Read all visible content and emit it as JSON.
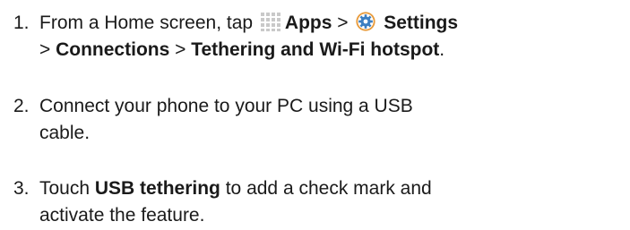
{
  "steps": [
    {
      "number": "1.",
      "line1": {
        "prefix": "From a Home screen, tap ",
        "apps_icon": "apps-grid-icon",
        "apps_label": "Apps",
        "sep1": " > ",
        "settings_icon": "settings-gear-icon",
        "settings_label": "Settings"
      },
      "line2": {
        "sep2": "> ",
        "connections_label": "Connections",
        "sep3": " > ",
        "tethering_label": "Tethering and Wi-Fi hotspot",
        "end": "."
      }
    },
    {
      "number": "2.",
      "line1": "Connect your phone to your PC using a USB",
      "line2": "cable."
    },
    {
      "number": "3.",
      "line1": {
        "prefix": "Touch ",
        "usb_label": "USB tethering",
        "suffix": " to add a check mark and"
      },
      "line2": "activate the feature."
    }
  ],
  "colors": {
    "text": "#1a1a1a",
    "apps_icon": "#c9c9c9",
    "settings_icon_outer": "#e89a3a",
    "settings_icon_inner": "#3c7fc2"
  }
}
